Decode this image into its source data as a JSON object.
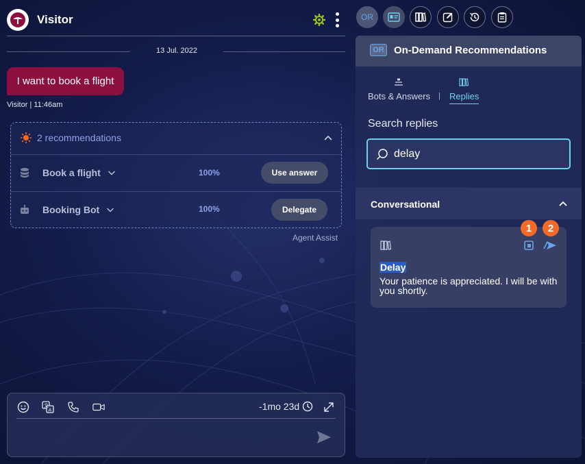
{
  "chat": {
    "visitor_name": "Visitor",
    "date": "13 Jul. 2022",
    "message": "I want to book a flight",
    "sender": "Visitor",
    "time": "11:46am",
    "recommendations": {
      "header": "2 recommendations",
      "rows": [
        {
          "label": "Book a flight",
          "percent": "100%",
          "action": "Use answer",
          "icon": "database-icon"
        },
        {
          "label": "Booking Bot",
          "percent": "100%",
          "action": "Delegate",
          "icon": "bot-icon"
        }
      ],
      "footer": "Agent Assist"
    },
    "composer": {
      "timer": "-1mo 23d"
    }
  },
  "toolbar": {
    "or_label": "OR",
    "icons": [
      "id-card-icon",
      "library-icon",
      "edit-icon",
      "history-icon",
      "clipboard-icon"
    ]
  },
  "panel": {
    "badge": "OR",
    "title": "On-Demand Recommendations",
    "tabs": [
      {
        "label": "Bots & Answers"
      },
      {
        "label": "Replies",
        "active": true
      }
    ],
    "tab_separator": "|",
    "search": {
      "label": "Search replies",
      "value": "delay"
    },
    "section": {
      "title": "Conversational"
    },
    "card": {
      "title": "Delay",
      "text": "Your patience is appreciated. I will be with you shortly.",
      "badges": [
        "1",
        "2"
      ]
    }
  },
  "colors": {
    "bubble": "#8c0f40",
    "accent": "#6fd0f0",
    "badge": "#f26a25",
    "recommendation": "#8ea2ea"
  }
}
